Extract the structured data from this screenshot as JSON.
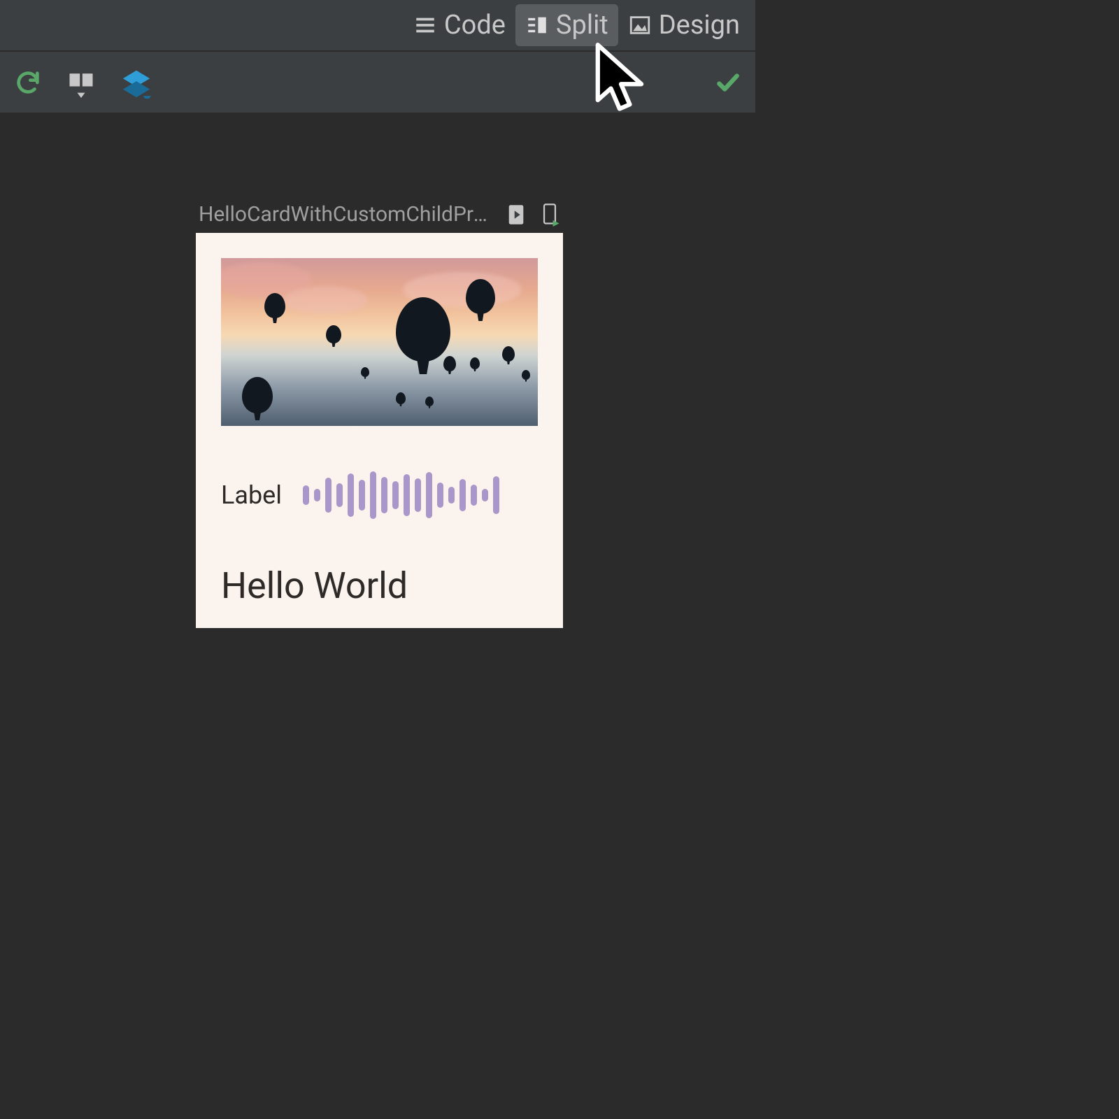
{
  "view_tabs": {
    "code": "Code",
    "split": "Split",
    "design": "Design",
    "active": "split"
  },
  "preview": {
    "title": "HelloCardWithCustomChildPrev..."
  },
  "card": {
    "label": "Label",
    "title": "Hello World",
    "waveform_heights": [
      28,
      18,
      50,
      34,
      62,
      44,
      68,
      52,
      40,
      60,
      48,
      66,
      36,
      24,
      46,
      30,
      18,
      54
    ]
  },
  "colors": {
    "accent_green": "#59a869",
    "layers_blue": "#2f9ed8",
    "waveform": "#a997c9",
    "card_bg": "#fbf3ee"
  }
}
